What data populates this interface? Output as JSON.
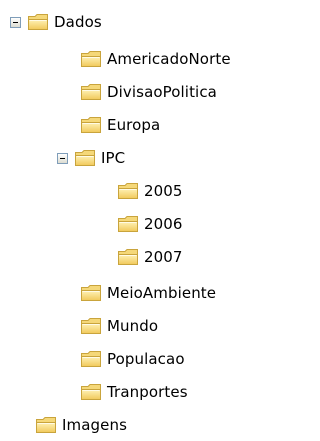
{
  "tree": {
    "root": {
      "label": "Dados",
      "icon": "folder-icon",
      "expanded": true
    },
    "children": [
      {
        "label": "AmericadoNorte",
        "icon": "folder-icon"
      },
      {
        "label": "DivisaoPolitica",
        "icon": "folder-icon"
      },
      {
        "label": "Europa",
        "icon": "folder-icon"
      },
      {
        "label": "IPC",
        "icon": "folder-icon",
        "expanded": true
      },
      {
        "label": "2005",
        "icon": "folder-icon"
      },
      {
        "label": "2006",
        "icon": "folder-icon"
      },
      {
        "label": "2007",
        "icon": "folder-icon"
      },
      {
        "label": "MeioAmbiente",
        "icon": "folder-icon"
      },
      {
        "label": "Mundo",
        "icon": "folder-icon"
      },
      {
        "label": "Populacao",
        "icon": "folder-icon"
      },
      {
        "label": "Tranportes",
        "icon": "folder-icon"
      }
    ],
    "sibling": {
      "label": "Imagens",
      "icon": "folder-icon"
    },
    "colors": {
      "folder_body": "#f5d879",
      "folder_outline": "#c9a43c",
      "expander_border": "#7f9db9"
    }
  }
}
